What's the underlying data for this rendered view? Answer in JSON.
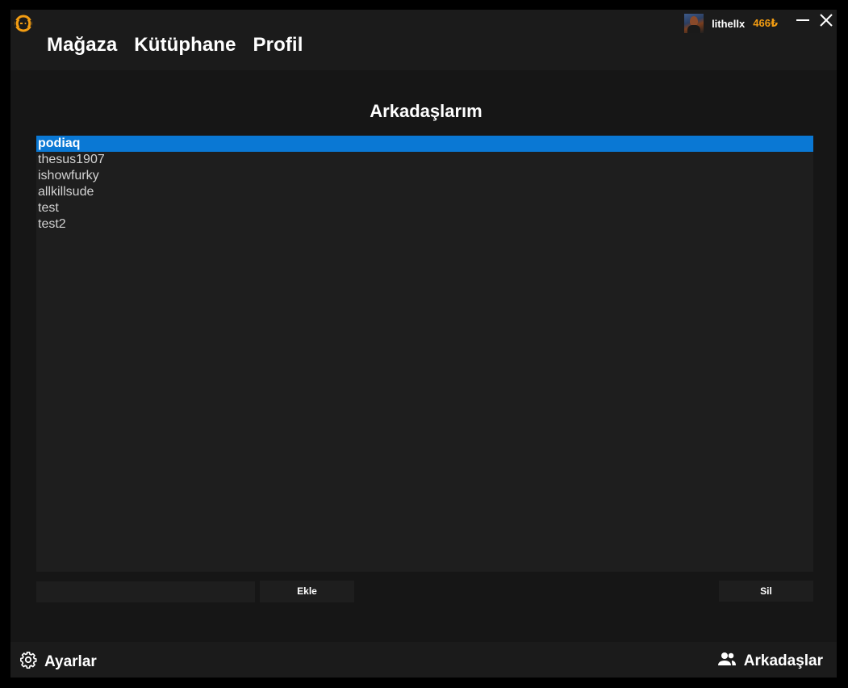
{
  "header": {
    "nav": [
      "Mağaza",
      "Kütüphane",
      "Profil"
    ],
    "user": {
      "name": "lithellx",
      "balance": "466₺"
    },
    "accent_color": "#f29c12",
    "logo_icon": "gamepad-logo-icon",
    "window_controls": [
      "minimize-icon",
      "close-icon"
    ]
  },
  "main": {
    "title": "Arkadaşlarım",
    "friends": [
      "podiaq",
      "thesus1907",
      "ishowfurky",
      "allkillsude",
      "test",
      "test2"
    ],
    "selected_index": 0,
    "selection_color": "#0a78d4",
    "input": {
      "value": "",
      "placeholder": ""
    },
    "add_label": "Ekle",
    "remove_label": "Sil"
  },
  "footer": {
    "settings_label": "Ayarlar",
    "settings_icon": "gear-icon",
    "friends_label": "Arkadaşlar",
    "friends_icon": "people-icon"
  }
}
